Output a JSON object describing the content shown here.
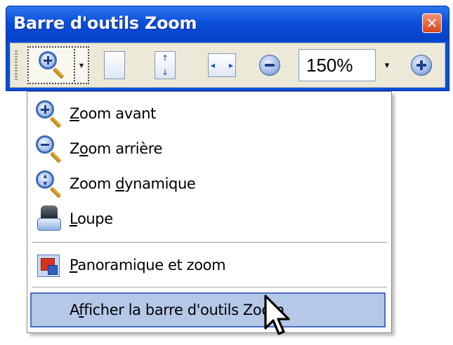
{
  "window": {
    "title": "Barre d'outils Zoom",
    "close_glyph": "✕"
  },
  "toolbar": {
    "zoom_tool_icon": "zoom-in-magnifier-icon",
    "zoom_dropdown_glyph": "▾",
    "single_page_icon": "single-page-icon",
    "fit_height_icon": "fit-height-icon",
    "fit_width_icon": "fit-width-icon",
    "zoom_out_icon": "zoom-out-circle-icon",
    "zoom_value": "150%",
    "zoom_value_dropdown_glyph": "▾",
    "zoom_in_icon": "zoom-in-circle-icon"
  },
  "menu": {
    "items": [
      {
        "label": "Zoom avant",
        "accel": "Z",
        "icon": "zoom-in-icon"
      },
      {
        "label": "Zoom arrière",
        "accel": "o",
        "icon": "zoom-out-icon"
      },
      {
        "label": "Zoom dynamique",
        "accel": "d",
        "icon": "dynamic-zoom-icon"
      },
      {
        "label": "Loupe",
        "accel": "L",
        "icon": "loupe-icon"
      },
      {
        "label": "Panoramique et zoom",
        "accel": "P",
        "icon": "pan-zoom-icon"
      },
      {
        "label": "Afficher la barre d'outils Zoom",
        "accel": "f",
        "selected": true
      }
    ]
  },
  "colors": {
    "titlebar": "#0a4cd8",
    "toolbar_bg": "#ece9d8",
    "menu_highlight": "#b6c8e8",
    "close_button": "#d8441a"
  }
}
